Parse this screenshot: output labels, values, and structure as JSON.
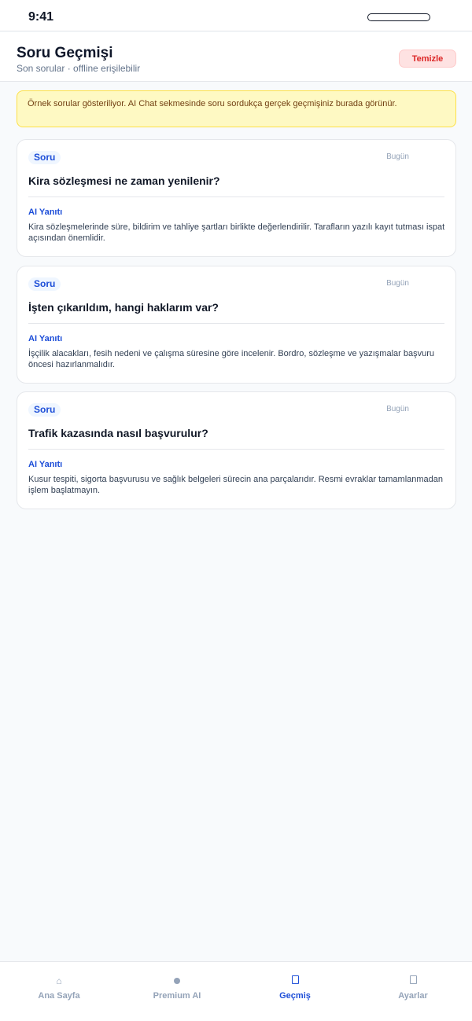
{
  "status_bar": {
    "time": "9:41"
  },
  "header": {
    "title": "Soru Geçmişi",
    "subtitle": "Son sorular · offline erişilebilir",
    "clear_label": "Temizle"
  },
  "notice": {
    "text": "Örnek sorular gösteriliyor. AI Chat sekmesinde soru sordukça gerçek geçmişiniz burada görünür."
  },
  "history": [
    {
      "badge": "Soru",
      "date": "Bugün",
      "question": "Kira sözleşmesi ne zaman yenilenir?",
      "answer_label": "AI Yanıtı",
      "answer": "Kira sözleşmelerinde süre, bildirim ve tahliye şartları birlikte değerlendirilir. Tarafların yazılı kayıt tutması ispat açısından önemlidir."
    },
    {
      "badge": "Soru",
      "date": "Bugün",
      "question": "İşten çıkarıldım, hangi haklarım var?",
      "answer_label": "AI Yanıtı",
      "answer": "İşçilik alacakları, fesih nedeni ve çalışma süresine göre incelenir. Bordro, sözleşme ve yazışmalar başvuru öncesi hazırlanmalıdır."
    },
    {
      "badge": "Soru",
      "date": "Bugün",
      "question": "Trafik kazasında nasıl başvurulur?",
      "answer_label": "AI Yanıtı",
      "answer": "Kusur tespiti, sigorta başvurusu ve sağlık belgeleri sürecin ana parçalarıdır. Resmi evraklar tamamlanmadan işlem başlatmayın."
    }
  ],
  "bottom_nav": [
    {
      "label": "Ana Sayfa",
      "icon": "home-icon",
      "glyph": "⌂",
      "active": false
    },
    {
      "label": "Premium AI",
      "icon": "dot-icon",
      "glyph": "",
      "active": false
    },
    {
      "label": "Geçmiş",
      "icon": "history-icon",
      "glyph": "",
      "active": true
    },
    {
      "label": "Ayarlar",
      "icon": "settings-icon",
      "glyph": "",
      "active": false
    }
  ],
  "colors": {
    "accent": "#1d4ed8",
    "danger": "#dc2626",
    "notice_bg": "#fef9c3",
    "notice_border": "#fde047"
  }
}
